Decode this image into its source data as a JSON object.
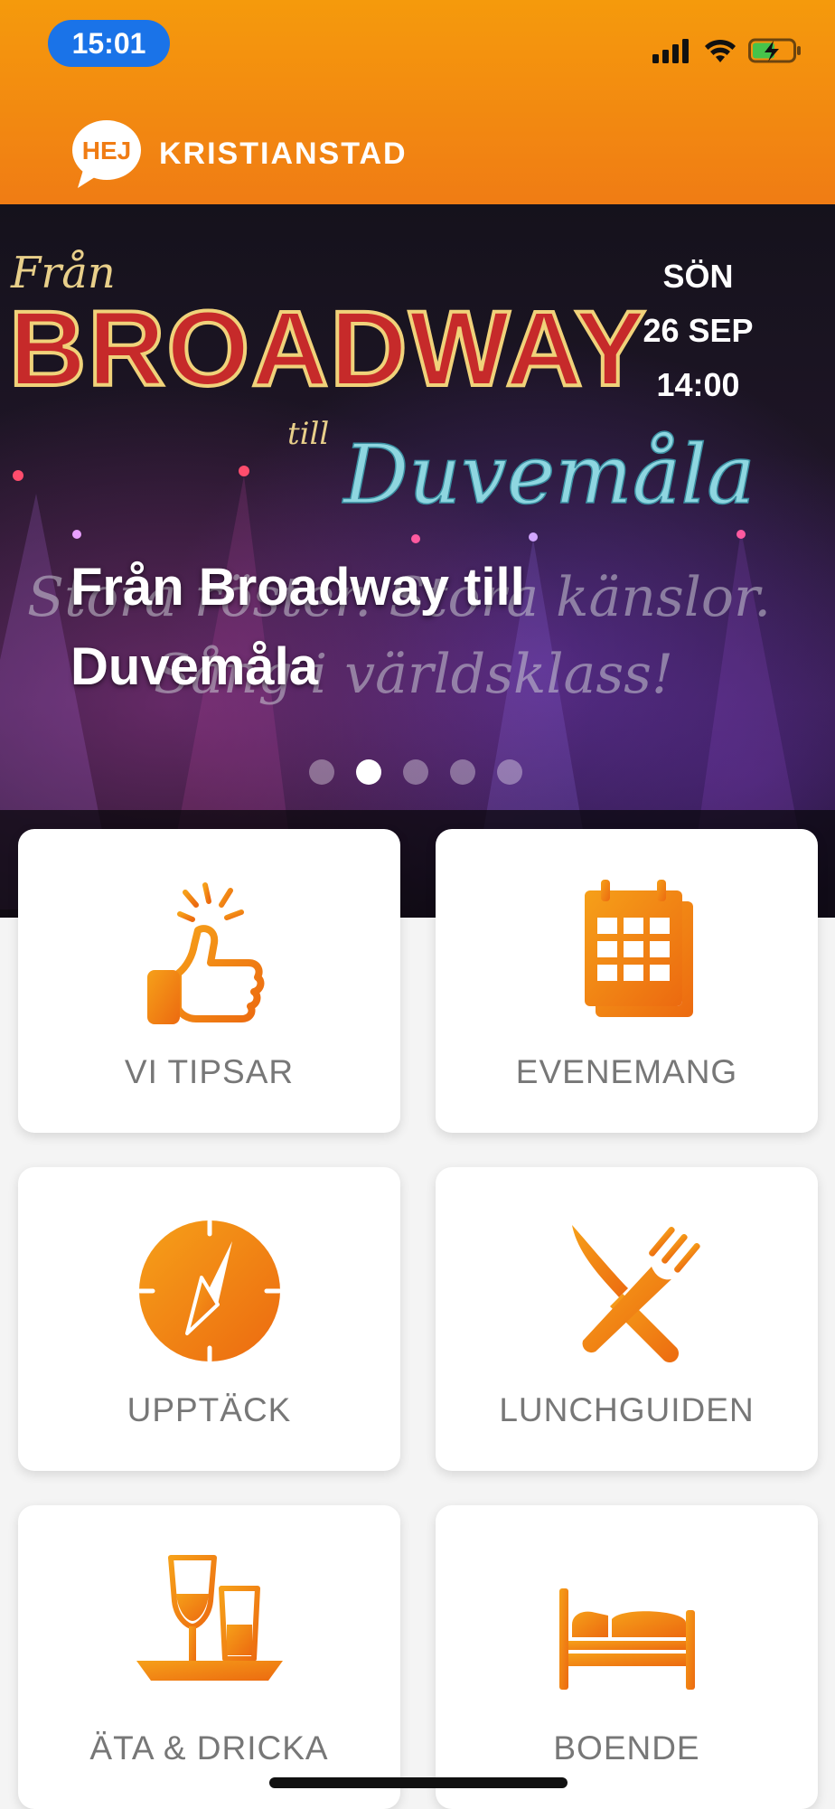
{
  "status_bar": {
    "time": "15:01",
    "icons": [
      "signal-icon",
      "wifi-icon",
      "battery-charging-icon"
    ]
  },
  "header": {
    "logo_text": "HEJ",
    "brand": "KRISTIANSTAD"
  },
  "hero": {
    "day": "SÖN",
    "date": "26 SEP",
    "time": "14:00",
    "title": "Från Broadway till Duvemåla",
    "poster_text": {
      "fran": "Från",
      "broadway": "BROADWAY",
      "till": "till",
      "duvemala": "Duvemåla",
      "tagline_1": "Stora röster. Stora känslor.",
      "tagline_2": "Sång i världsklass!"
    },
    "carousel_count": 5,
    "carousel_active": 1
  },
  "tiles": [
    {
      "label": "VI TIPSAR",
      "icon": "thumbs-up-icon"
    },
    {
      "label": "EVENEMANG",
      "icon": "calendar-icon"
    },
    {
      "label": "UPPTÄCK",
      "icon": "compass-icon"
    },
    {
      "label": "LUNCHGUIDEN",
      "icon": "knife-fork-icon"
    },
    {
      "label": "ÄTA & DRICKA",
      "icon": "drinks-tray-icon"
    },
    {
      "label": "BOENDE",
      "icon": "bed-icon"
    }
  ],
  "colors": {
    "accent": "#f07c14",
    "accent_light": "#f59a0c",
    "time_pill": "#1a73e8"
  }
}
